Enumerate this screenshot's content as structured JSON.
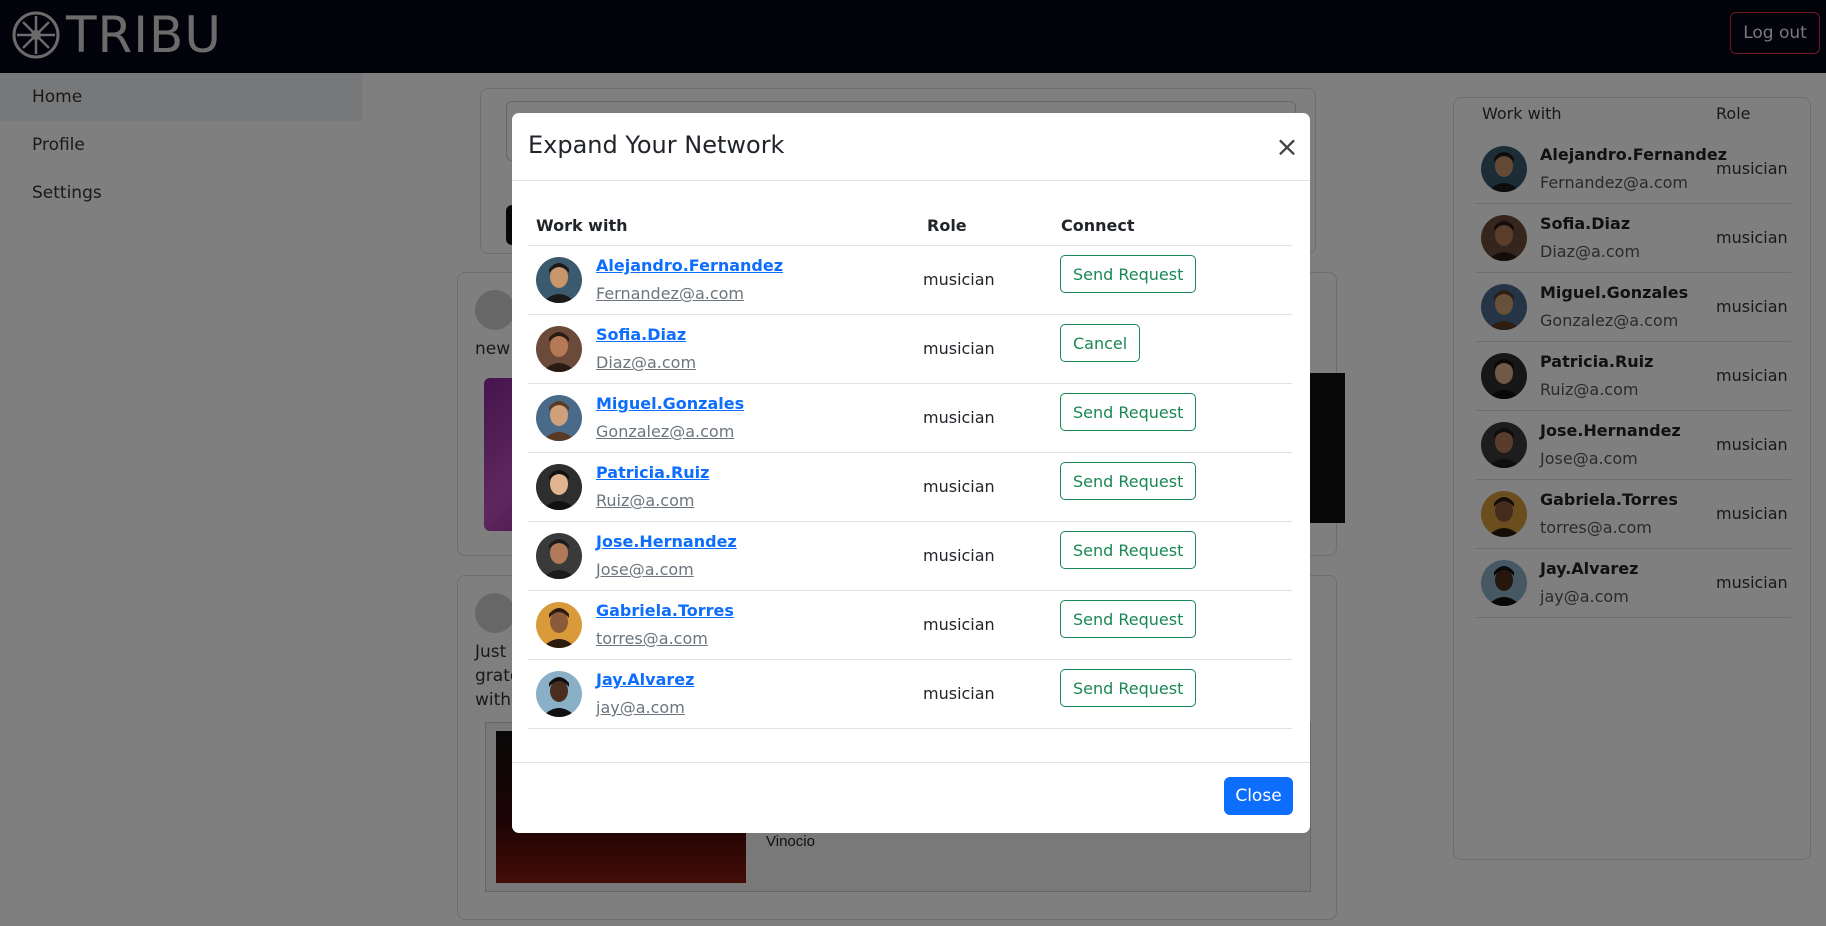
{
  "navbar": {
    "brand": "TRIBU",
    "logout_label": "Log out"
  },
  "sidebar": {
    "items": [
      {
        "label": "Home"
      },
      {
        "label": "Profile"
      },
      {
        "label": "Settings"
      }
    ]
  },
  "feed": {
    "post1_text": "new s",
    "post2_text_lines": [
      "Just",
      "grate",
      "with"
    ],
    "video_caption": "Vinocio"
  },
  "right_panel": {
    "headers": {
      "work_with": "Work with",
      "role": "Role"
    },
    "rows": [
      {
        "name": "Alejandro.Fernandez",
        "email": "Fernandez@a.com",
        "role": "musician"
      },
      {
        "name": "Sofia.Diaz",
        "email": "Diaz@a.com",
        "role": "musician"
      },
      {
        "name": "Miguel.Gonzales",
        "email": "Gonzalez@a.com",
        "role": "musician"
      },
      {
        "name": "Patricia.Ruiz",
        "email": "Ruiz@a.com",
        "role": "musician"
      },
      {
        "name": "Jose.Hernandez",
        "email": "Jose@a.com",
        "role": "musician"
      },
      {
        "name": "Gabriela.Torres",
        "email": "torres@a.com",
        "role": "musician"
      },
      {
        "name": "Jay.Alvarez",
        "email": "jay@a.com",
        "role": "musician"
      }
    ]
  },
  "modal": {
    "title": "Expand Your Network",
    "close_icon": "×",
    "headers": {
      "work_with": "Work with",
      "role": "Role",
      "connect": "Connect"
    },
    "rows": [
      {
        "name": "Alejandro.Fernandez",
        "email": "Fernandez@a.com",
        "role": "musician",
        "action": "Send Request"
      },
      {
        "name": "Sofia.Diaz",
        "email": "Diaz@a.com",
        "role": "musician",
        "action": "Cancel"
      },
      {
        "name": "Miguel.Gonzales",
        "email": "Gonzalez@a.com",
        "role": "musician",
        "action": "Send Request"
      },
      {
        "name": "Patricia.Ruiz",
        "email": "Ruiz@a.com",
        "role": "musician",
        "action": "Send Request"
      },
      {
        "name": "Jose.Hernandez",
        "email": "Jose@a.com",
        "role": "musician",
        "action": "Send Request"
      },
      {
        "name": "Gabriela.Torres",
        "email": "torres@a.com",
        "role": "musician",
        "action": "Send Request"
      },
      {
        "name": "Jay.Alvarez",
        "email": "jay@a.com",
        "role": "musician",
        "action": "Send Request"
      }
    ],
    "footer_close_label": "Close"
  },
  "colors": {
    "navbar_bg": "#050714",
    "link_blue": "#0d6efd",
    "success_green": "#198754",
    "logout_border": "#dc3545",
    "primary_button": "#0d6efd"
  }
}
